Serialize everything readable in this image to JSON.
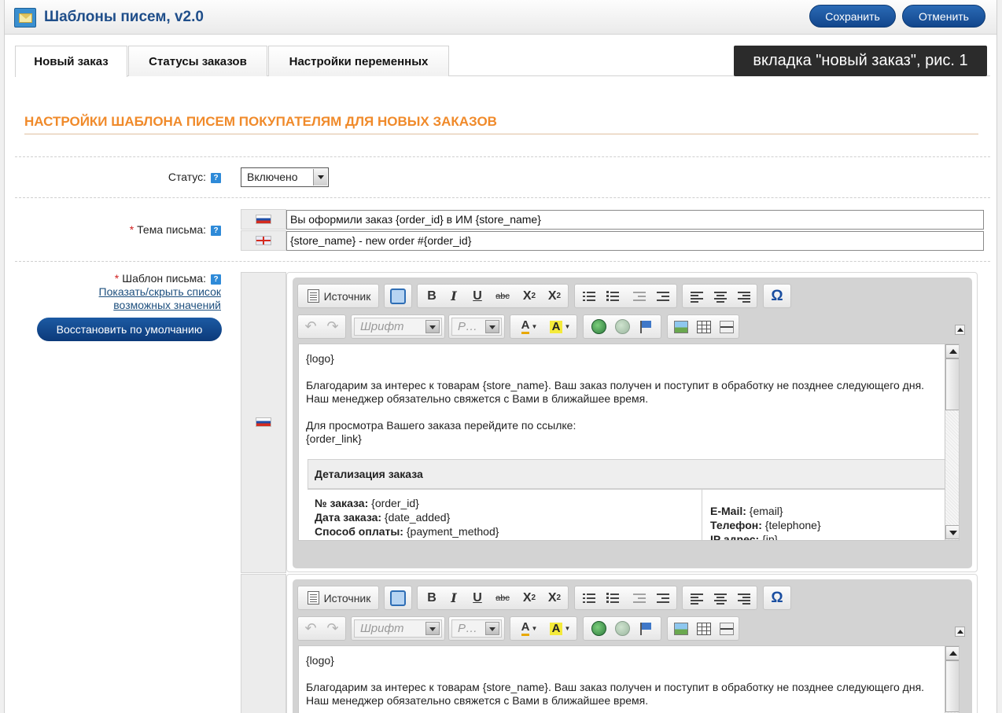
{
  "header": {
    "title": "Шаблоны писем, v2.0",
    "save_label": "Сохранить",
    "cancel_label": "Отменить"
  },
  "tabs": [
    {
      "label": "Новый заказ",
      "active": true
    },
    {
      "label": "Статусы заказов",
      "active": false
    },
    {
      "label": "Настройки переменных",
      "active": false
    }
  ],
  "annotation": "вкладка \"новый заказ\", рис. 1",
  "section_title": "НАСТРОЙКИ ШАБЛОНА ПИСЕМ ПОКУПАТЕЛЯМ ДЛЯ НОВЫХ ЗАКАЗОВ",
  "status": {
    "label": "Статус:",
    "value": "Включено"
  },
  "subject": {
    "label": "Тема письма:",
    "ru": "Вы оформили заказ {order_id} в ИМ {store_name}",
    "en": "{store_name} - new order #{order_id}"
  },
  "template": {
    "label": "Шаблон письма:",
    "toggle_link_1": "Показать/скрыть список",
    "toggle_link_2": "возможных значений",
    "restore_label": "Восстановить по умолчанию"
  },
  "toolbar": {
    "source_label": "Источник",
    "font_placeholder": "Шрифт",
    "size_placeholder": "Р…",
    "bold": "B",
    "italic": "I",
    "underline": "U",
    "strike": "abc",
    "sub": "X",
    "sup": "X",
    "font_color": "A",
    "bg_color": "A",
    "omega": "Ω"
  },
  "editor_content": {
    "logo": "{logo}",
    "p1": "Благодарим за интерес к товарам {store_name}. Ваш заказ получен и поступит в обработку не позднее следующего дня. Наш менеджер обязательно свяжется с Вами в ближайшее время.",
    "p2a": "Для просмотра Вашего заказа перейдите по ссылке:",
    "p2b": "{order_link}",
    "table_header": "Детализация заказа",
    "order_id_label": "№ заказа:",
    "order_id_value": " {order_id}",
    "date_label": "Дата заказа:",
    "date_value": " {date_added}",
    "payment_label": "Способ оплаты:",
    "payment_value": " {payment_method}",
    "email_label": "E-Mail:",
    "email_value": " {email}",
    "phone_label": "Телефон:",
    "phone_value": " {telephone}",
    "ip_label": "IP адрес:",
    "ip_value": " {ip}"
  },
  "colors": {
    "accent_orange": "#f08a2a",
    "title_blue": "#1f4e8a",
    "button_blue": "#12468c"
  }
}
